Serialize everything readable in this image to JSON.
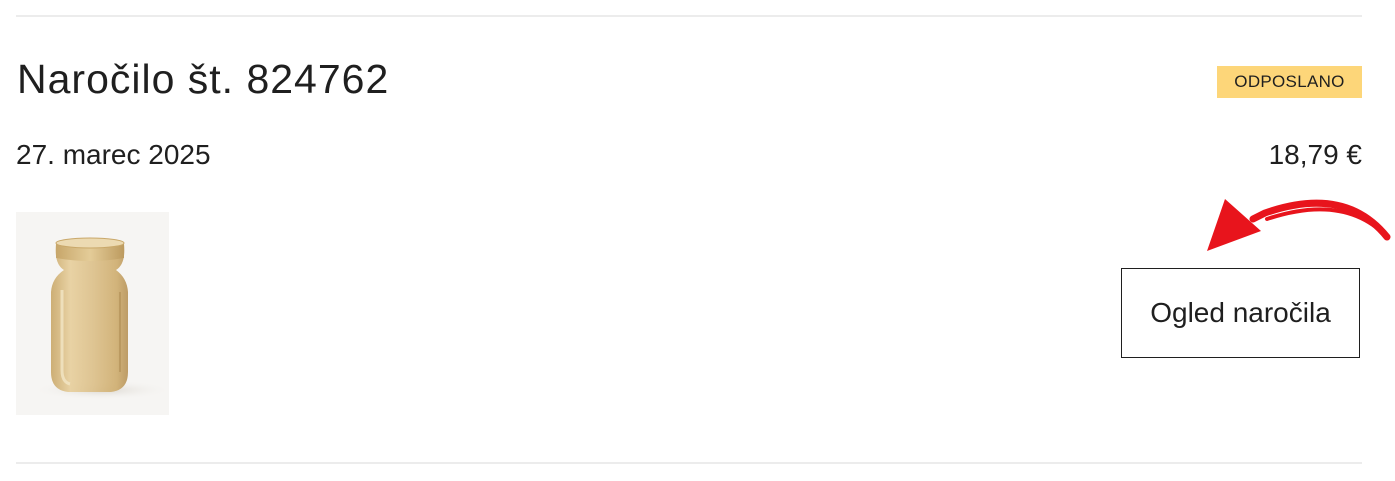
{
  "order": {
    "title": "Naročilo št. 824762",
    "status": "ODPOSLANO",
    "date": "27. marec 2025",
    "total": "18,79 €",
    "view_button_label": "Ogled naročila",
    "product_image_icon": "glass-vase-icon"
  },
  "annotation": {
    "arrow_color": "#e8141c"
  },
  "colors": {
    "badge_background": "#fdd679",
    "divider": "#ececec"
  }
}
